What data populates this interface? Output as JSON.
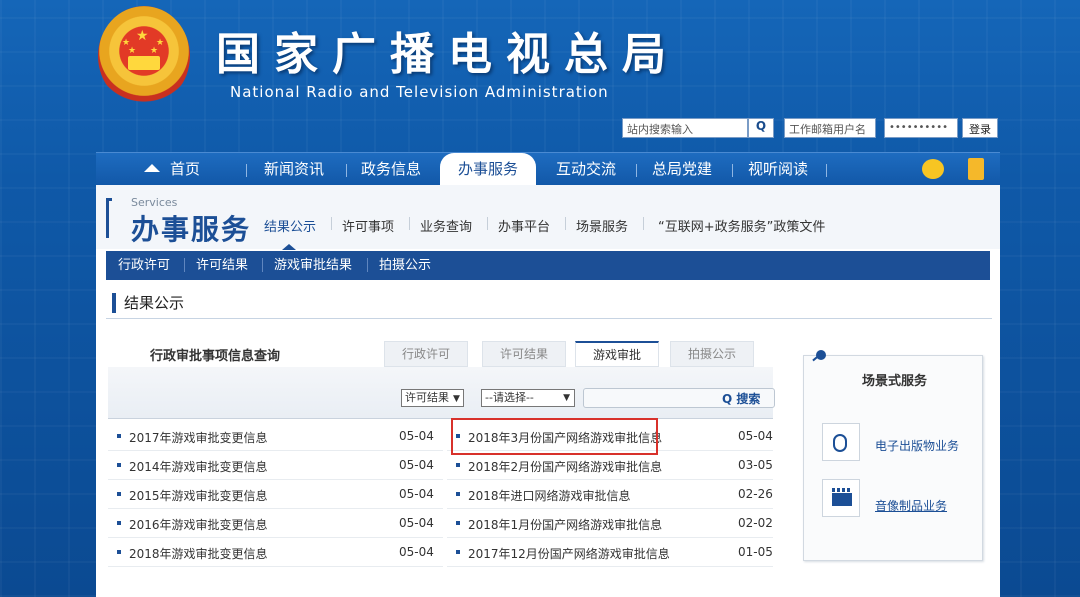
{
  "header": {
    "title_cn": "国家广播电视总局",
    "title_en": "National Radio and Television Administration",
    "search_placeholder": "站内搜索输入",
    "mail_placeholder": "工作邮箱用户名",
    "password_dots": "••••••••••",
    "login_label": "登录"
  },
  "nav": {
    "items": [
      "首页",
      "新闻资讯",
      "政务信息",
      "办事服务",
      "互动交流",
      "总局党建",
      "视听阅读"
    ],
    "active": "办事服务"
  },
  "section": {
    "services_en": "Services",
    "title": "办事服务",
    "subnav": [
      "结果公示",
      "许可事项",
      "业务查询",
      "办事平台",
      "场景服务",
      "“互联网+政务服务”政策文件"
    ]
  },
  "subbar": {
    "items": [
      "行政许可",
      "许可结果",
      "游戏审批结果",
      "拍摄公示"
    ]
  },
  "results": {
    "heading": "结果公示",
    "query_title": "行政审批事项信息查询",
    "tabs": [
      "行政许可",
      "许可结果",
      "游戏审批",
      "拍摄公示"
    ],
    "active_tab": "游戏审批",
    "filter_select1": "许可结果",
    "filter_select2": "--请选择--",
    "search_label": "搜索",
    "left_rows": [
      {
        "title": "2017年游戏审批变更信息",
        "date": "05-04"
      },
      {
        "title": "2014年游戏审批变更信息",
        "date": "05-04"
      },
      {
        "title": "2015年游戏审批变更信息",
        "date": "05-04"
      },
      {
        "title": "2016年游戏审批变更信息",
        "date": "05-04"
      },
      {
        "title": "2018年游戏审批变更信息",
        "date": "05-04"
      }
    ],
    "right_rows": [
      {
        "title": "2018年3月份国产网络游戏审批信息",
        "date": "05-04"
      },
      {
        "title": "2018年2月份国产网络游戏审批信息",
        "date": "03-05"
      },
      {
        "title": "2018年进口网络游戏审批信息",
        "date": "02-26"
      },
      {
        "title": "2018年1月份国产网络游戏审批信息",
        "date": "02-02"
      },
      {
        "title": "2017年12月份国产网络游戏审批信息",
        "date": "01-05"
      }
    ]
  },
  "sidebar": {
    "title": "场景式服务",
    "links": [
      "电子出版物业务",
      "音像制品业务"
    ]
  },
  "colors": {
    "primary": "#1c4f96",
    "highlight_border": "#d8312b",
    "background": "#0f59a8"
  },
  "icons": [
    "home-icon",
    "search-icon",
    "chat-icon",
    "mobile-icon",
    "mouse-icon",
    "clapperboard-icon",
    "pin-icon"
  ]
}
